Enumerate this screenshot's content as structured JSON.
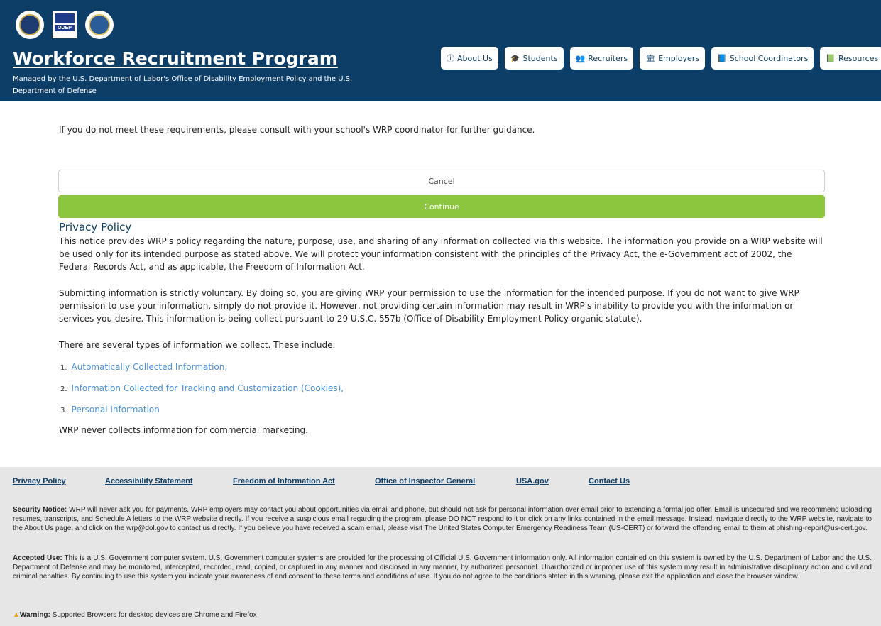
{
  "header": {
    "title": "Workforce Recruitment Program",
    "subtitle": "Managed by the U.S. Department of Labor's Office of Disability Employment Policy and the U.S. Department of Defense",
    "odep_text": "ODEP",
    "nav": [
      {
        "label": "About Us",
        "icon": "info-circle-icon",
        "glyph": "ⓘ"
      },
      {
        "label": "Students",
        "icon": "graduation-cap-icon",
        "glyph": "🎓"
      },
      {
        "label": "Recruiters",
        "icon": "users-icon",
        "glyph": "👥"
      },
      {
        "label": "Employers",
        "icon": "institution-icon",
        "glyph": "🏛"
      },
      {
        "label": "School Coordinators",
        "icon": "book-icon",
        "glyph": "📘"
      },
      {
        "label": "Resources",
        "icon": "book-open-icon",
        "glyph": "📗"
      }
    ]
  },
  "main": {
    "requirements_note": "If you do not meet these requirements, please consult with your school's WRP coordinator for further guidance.",
    "cancel_label": "Cancel",
    "continue_label": "Continue",
    "privacy_title": "Privacy Policy",
    "p1": "This notice provides WRP's policy regarding the nature, purpose, use, and sharing of any information collected via this website. The information you provide on a WRP website will be used only for its intended purpose as stated above. We will protect your information consistent with the principles of the Privacy Act, the e-Government act of 2002, the Federal Records Act, and as applicable, the Freedom of Information Act.",
    "p2": "Submitting information is strictly voluntary. By doing so, you are giving WRP your permission to use the information for the intended purpose. If you do not want to give WRP permission to use your information, simply do not provide it. However, not providing certain information may result in WRP's inability to provide you with the information or services you desire. This information is being collect pursuant to 29 U.S.C. 557b (Office of Disability Employment Policy organic statute).",
    "p3": "There are several types of information we collect. These include:",
    "list": [
      {
        "num": "1.",
        "label": "Automatically Collected Information,"
      },
      {
        "num": "2.",
        "label": "Information Collected for Tracking and Customization (Cookies),"
      },
      {
        "num": "3.",
        "label": "Personal Information"
      }
    ],
    "p4": "WRP never collects information for commercial marketing."
  },
  "footer": {
    "links": [
      "Privacy Policy",
      "Accessibility Statement",
      "Freedom of Information Act",
      "Office of Inspector General",
      "USA.gov",
      "Contact Us"
    ],
    "security_label": "Security Notice:",
    "security_text": " WRP will never ask you for payments. WRP employers may contact you about opportunities via email and phone, but should not ask for personal information over email prior to extending a formal job offer. Email is unsecured and we recommend uploading resumes, transcripts, and Schedule A letters to the WRP website directly. If you receive a suspicious email regarding the program, please DO NOT respond to it or click on any links contained in the email message. Instead, navigate directly to the WRP website, navigate to the About Us page, and click on the wrp@dol.gov to contact us directly. If you believe you have received a scam email, please visit The United States Computer Emergency Readiness Team (US-CERT) or forward the offending email to them at phishing-report@us-cert.gov.",
    "accepted_label": "Accepted Use:",
    "accepted_text": " This is a U.S. Government computer system. U.S. Government computer systems are provided for the processing of Official U.S. Government information only. All information contained on this system is owned by the U.S. Department of Labor and the U.S. Department of Defense and may be monitored, intercepted, recorded, read, copied, or captured in any manner and disclosed in any manner, by authorized personnel. Unauthorized or improper use of this system may result in administrative disciplinary action and civil and criminal penalties. By continuing to use this system you indicate your awareness of and consent to these terms and conditions of use. If you do not agree to the conditions stated in this warning, please exit the application and close the browser window.",
    "warning_label": "Warning:",
    "warning_text": " Supported Browsers for desktop devices are Chrome and Firefox"
  },
  "colors": {
    "header_bg": "#0d3e67",
    "continue_bg": "#8cc63f",
    "link": "#4a90d9",
    "footer_bg": "#e6e6e6"
  }
}
